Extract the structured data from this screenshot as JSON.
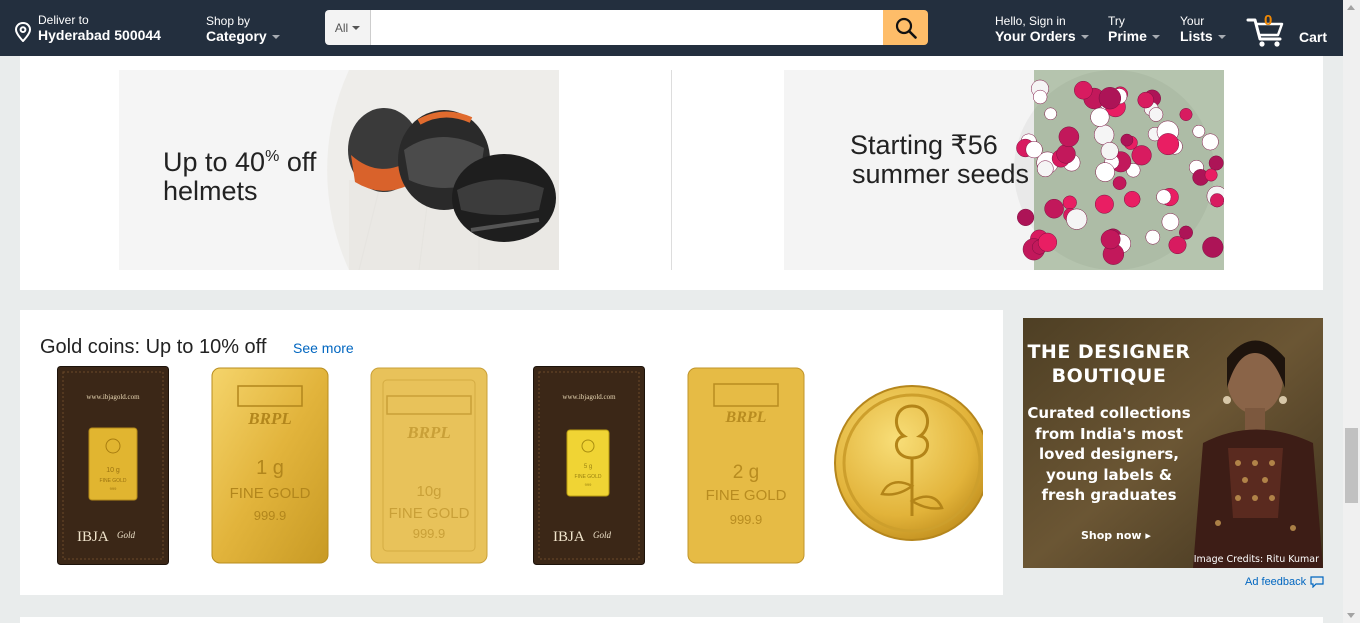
{
  "header": {
    "deliver_line1": "Deliver to",
    "deliver_line2": "Hyderabad 500044",
    "shop_line1": "Shop by",
    "shop_line2": "Category",
    "search_dept": "All",
    "search_placeholder": "",
    "account_line1": "Hello, Sign in",
    "account_line2": "Your Orders",
    "prime_line1": "Try",
    "prime_line2": "Prime",
    "lists_line1": "Your",
    "lists_line2": "Lists",
    "cart_count": "0",
    "cart_label": "Cart"
  },
  "promos": [
    {
      "line1": "Up to 40% off",
      "line1_a": "Up to 40",
      "line1_pct": "%",
      "line1_b": " off",
      "line2": "helmets"
    },
    {
      "line1": "Starting ₹56",
      "line2": "summer seeds"
    }
  ],
  "gold": {
    "title": "Gold coins: Up to 10% off",
    "see_more": "See more",
    "products": [
      {
        "type": "ibja",
        "site": "www.ibjagold.com",
        "weight": "10 g",
        "purity": "FINE GOLD",
        "fineness": "999",
        "brand": "IBJA",
        "brand_script": "Gold"
      },
      {
        "type": "brpl-bar",
        "logo": "BRPL",
        "weight": "1 g",
        "purity": "FINE GOLD",
        "fineness": "999.9"
      },
      {
        "type": "brpl-bar",
        "logo": "BRPL",
        "weight": "10g",
        "purity": "FINE GOLD",
        "fineness": "999.9"
      },
      {
        "type": "ibja",
        "site": "www.ibjagold.com",
        "weight": "5 g",
        "purity": "FINE GOLD",
        "fineness": "999",
        "brand": "IBJA",
        "brand_script": "Gold"
      },
      {
        "type": "brpl-bar",
        "logo": "BRPL",
        "weight": "2 g",
        "purity": "FINE GOLD",
        "fineness": "999.9"
      },
      {
        "type": "coin"
      }
    ]
  },
  "ad": {
    "headline_1": "THE DESIGNER",
    "headline_2": "BOUTIQUE",
    "body_1": "Curated collections",
    "body_2": "from India's most",
    "body_3": "loved designers,",
    "body_4": "young labels &",
    "body_5": "fresh graduates",
    "cta": "Shop now ▸",
    "credit": "Image Credits: Ritu Kumar",
    "feedback": "Ad feedback"
  },
  "colors": {
    "header_bg": "#232f3e",
    "search_button": "#febd69",
    "cart_count": "#f08804",
    "link": "#0066c0",
    "gold": "#e3b03a"
  }
}
